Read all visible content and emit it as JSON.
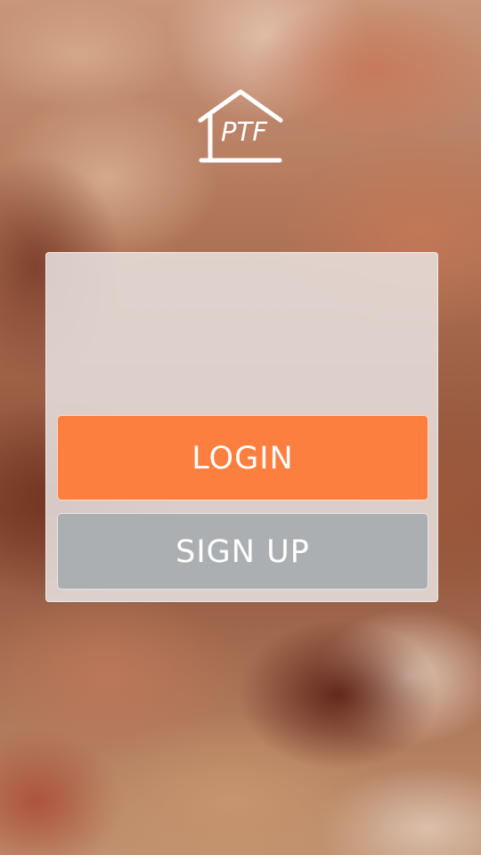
{
  "app": {
    "logo_text": "PTF"
  },
  "auth": {
    "login_label": "LOGIN",
    "signup_label": "SIGN UP"
  },
  "colors": {
    "login_button": "#fd7f40",
    "signup_button": "#acafb2",
    "panel": "#e8e2e0"
  },
  "icons": {
    "logo": "house-icon"
  }
}
